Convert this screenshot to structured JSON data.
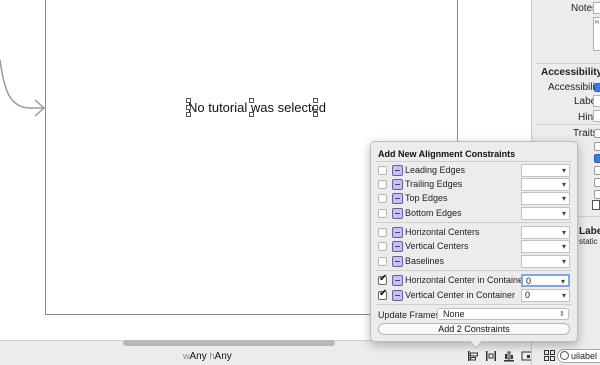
{
  "canvas": {
    "label_text": "No tutorial was selected"
  },
  "bottom_bar": {
    "width_prefix": "w",
    "width_value": "Any",
    "height_prefix": "h",
    "height_value": "Any",
    "icons": [
      "align-icon",
      "pin-icon",
      "resolve-icon",
      "resizing-icon"
    ]
  },
  "inspector": {
    "notes_label": "Notes",
    "notes_field_char": "ᵐ",
    "accessibility_header": "Accessibility",
    "accessibility_label": "Accessibility",
    "label_label": "Label",
    "hint_label": "Hint",
    "traits_label": "Traits",
    "library_label": "Label",
    "library_sub": "static t",
    "search_value": "uilabel"
  },
  "popover": {
    "title": "Add New Alignment Constraints",
    "constraints": [
      {
        "label": "Leading Edges",
        "checked": false,
        "value": ""
      },
      {
        "label": "Trailing Edges",
        "checked": false,
        "value": ""
      },
      {
        "label": "Top Edges",
        "checked": false,
        "value": ""
      },
      {
        "label": "Bottom Edges",
        "checked": false,
        "value": ""
      },
      {
        "label": "Horizontal Centers",
        "checked": false,
        "value": ""
      },
      {
        "label": "Vertical Centers",
        "checked": false,
        "value": ""
      },
      {
        "label": "Baselines",
        "checked": false,
        "value": ""
      },
      {
        "label": "Horizontal Center in Container",
        "checked": true,
        "value": "0"
      },
      {
        "label": "Vertical Center in Container",
        "checked": true,
        "value": "0"
      }
    ],
    "update_frames_label": "Update Frames",
    "update_frames_value": "None",
    "add_button_label": "Add 2 Constraints"
  }
}
